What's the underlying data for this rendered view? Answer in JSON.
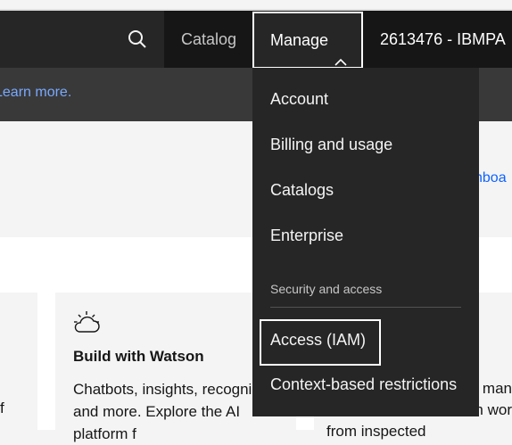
{
  "header": {
    "search_icon": "search-icon",
    "catalog_label": "Catalog",
    "manage_label": "Manage",
    "manage_chevron": "chevron-up-icon",
    "account_label": "2613476 - IBMPA"
  },
  "notice": {
    "link_text": "Learn more."
  },
  "band": {
    "link_fragment": "hboa"
  },
  "cards": {
    "left_fragment": "f",
    "watson": {
      "icon": "cloud-sun-icon",
      "title": "Build with Watson",
      "description": "Chatbots, insights, recognizers, and more. Explore the AI platform f"
    },
    "right_fragment_1": "man",
    "right_fragment_2": "n wor",
    "right_fragment_3": "from inspected"
  },
  "menu": {
    "items": [
      "Account",
      "Billing and usage",
      "Catalogs",
      "Enterprise"
    ],
    "section_label": "Security and access",
    "security_items": [
      "Access (IAM)",
      "Context-based restrictions"
    ]
  },
  "colors": {
    "header_bg": "#161616",
    "menu_bg": "#262626",
    "link_blue": "#78a9ff",
    "focus_border": "#ffffff"
  }
}
